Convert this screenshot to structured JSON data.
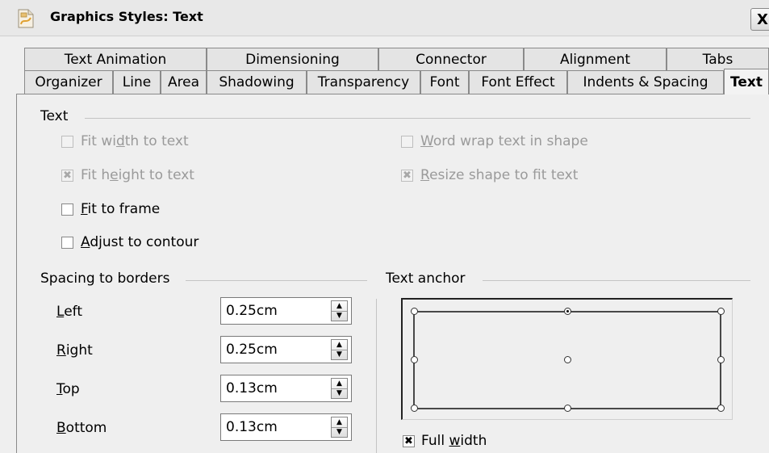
{
  "window": {
    "title": "Graphics Styles: Text",
    "close_label": "X"
  },
  "tabs_row1": [
    "Text Animation",
    "Dimensioning",
    "Connector",
    "Alignment",
    "Tabs"
  ],
  "tabs_row2": [
    "Organizer",
    "Line",
    "Area",
    "Shadowing",
    "Transparency",
    "Font",
    "Font Effect",
    "Indents & Spacing",
    "Text"
  ],
  "active_tab": "Text",
  "text_section": {
    "heading": "Text",
    "fit_width": {
      "pre": "Fit wi",
      "accel": "d",
      "post": "th to text",
      "checked": false,
      "enabled": false
    },
    "fit_height": {
      "pre": "Fit h",
      "accel": "e",
      "post": "ight to text",
      "checked": true,
      "enabled": false
    },
    "fit_frame": {
      "pre": "",
      "accel": "F",
      "post": "it to frame",
      "checked": false,
      "enabled": true
    },
    "adjust_contour": {
      "pre": "",
      "accel": "A",
      "post": "djust to contour",
      "checked": false,
      "enabled": true
    },
    "word_wrap": {
      "pre": "",
      "accel": "W",
      "post": "ord wrap text in shape",
      "checked": false,
      "enabled": false
    },
    "resize_shape": {
      "pre": "",
      "accel": "R",
      "post": "esize shape to fit text",
      "checked": true,
      "enabled": false
    }
  },
  "spacing": {
    "heading": "Spacing to borders",
    "left": {
      "accel": "L",
      "rest": "eft",
      "value": "0.25cm"
    },
    "right": {
      "accel": "R",
      "rest": "ight",
      "value": "0.25cm"
    },
    "top": {
      "accel": "T",
      "rest": "op",
      "value": "0.13cm"
    },
    "bottom": {
      "accel": "B",
      "rest": "ottom",
      "value": "0.13cm"
    }
  },
  "anchor": {
    "heading": "Text anchor",
    "selected": "top-center",
    "full_width": {
      "pre": "Full ",
      "accel": "w",
      "post": "idth",
      "checked": true
    }
  }
}
